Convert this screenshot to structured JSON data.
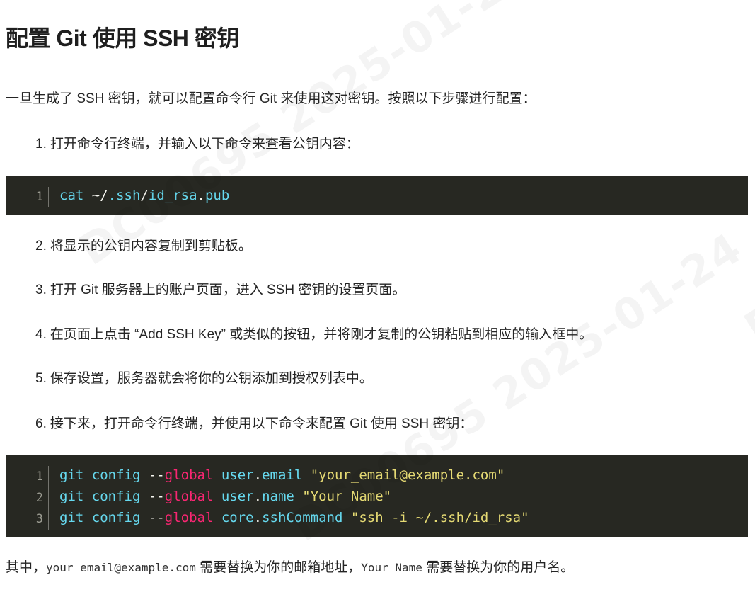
{
  "title": "配置 Git 使用 SSH 密钥",
  "watermark": "DC00695 2025-01-24",
  "intro": "一旦生成了 SSH 密钥，就可以配置命令行 Git 来使用这对密钥。按照以下步骤进行配置：",
  "steps": [
    {
      "num": "1.",
      "text": "打开命令行终端，并输入以下命令来查看公钥内容："
    },
    {
      "num": "2.",
      "text": "将显示的公钥内容复制到剪贴板。"
    },
    {
      "num": "3.",
      "text": "打开 Git 服务器上的账户页面，进入 SSH 密钥的设置页面。"
    },
    {
      "num": "4.",
      "text": "在页面上点击 “Add SSH Key” 或类似的按钮，并将刚才复制的公钥粘贴到相应的输入框中。"
    },
    {
      "num": "5.",
      "text": "保存设置，服务器就会将你的公钥添加到授权列表中。"
    },
    {
      "num": "6.",
      "text": "接下来，打开命令行终端，并使用以下命令来配置 Git 使用 SSH 密钥："
    }
  ],
  "code_block_1": {
    "lines": [
      {
        "ln": "1",
        "tokens": [
          {
            "t": "cat",
            "c": "cmd"
          },
          {
            "t": " ~/",
            "c": "white"
          },
          {
            "t": ".ssh",
            "c": "path"
          },
          {
            "t": "/",
            "c": "white"
          },
          {
            "t": "id_rsa",
            "c": "path"
          },
          {
            "t": ".",
            "c": "white"
          },
          {
            "t": "pub",
            "c": "path"
          }
        ]
      }
    ]
  },
  "code_block_2": {
    "lines": [
      {
        "ln": "1",
        "tokens": [
          {
            "t": "git",
            "c": "cmd"
          },
          {
            "t": " ",
            "c": "white"
          },
          {
            "t": "config",
            "c": "cmd"
          },
          {
            "t": " --",
            "c": "white"
          },
          {
            "t": "global",
            "c": "global"
          },
          {
            "t": " ",
            "c": "white"
          },
          {
            "t": "user",
            "c": "attr"
          },
          {
            "t": ".",
            "c": "white"
          },
          {
            "t": "email",
            "c": "attr"
          },
          {
            "t": " ",
            "c": "white"
          },
          {
            "t": "\"your_email@example.com\"",
            "c": "str"
          }
        ]
      },
      {
        "ln": "2",
        "tokens": [
          {
            "t": "git",
            "c": "cmd"
          },
          {
            "t": " ",
            "c": "white"
          },
          {
            "t": "config",
            "c": "cmd"
          },
          {
            "t": " --",
            "c": "white"
          },
          {
            "t": "global",
            "c": "global"
          },
          {
            "t": " ",
            "c": "white"
          },
          {
            "t": "user",
            "c": "attr"
          },
          {
            "t": ".",
            "c": "white"
          },
          {
            "t": "name",
            "c": "attr"
          },
          {
            "t": " ",
            "c": "white"
          },
          {
            "t": "\"Your Name\"",
            "c": "str"
          }
        ]
      },
      {
        "ln": "3",
        "tokens": [
          {
            "t": "git",
            "c": "cmd"
          },
          {
            "t": " ",
            "c": "white"
          },
          {
            "t": "config",
            "c": "cmd"
          },
          {
            "t": " --",
            "c": "white"
          },
          {
            "t": "global",
            "c": "global"
          },
          {
            "t": " ",
            "c": "white"
          },
          {
            "t": "core",
            "c": "attr"
          },
          {
            "t": ".",
            "c": "white"
          },
          {
            "t": "sshCommand",
            "c": "attr"
          },
          {
            "t": " ",
            "c": "white"
          },
          {
            "t": "\"ssh -i ~/.ssh/id_rsa\"",
            "c": "str"
          }
        ]
      }
    ]
  },
  "outro": {
    "prefix": "其中，",
    "code1": "your_email@example.com",
    "mid": " 需要替换为你的邮箱地址，",
    "code2": "Your Name",
    "suffix": " 需要替换为你的用户名。"
  },
  "colors": {
    "code_bg": "#272822",
    "keyword": "#66d9ef",
    "global": "#f92672",
    "string": "#e6db74",
    "plain": "#f8f8f2"
  }
}
